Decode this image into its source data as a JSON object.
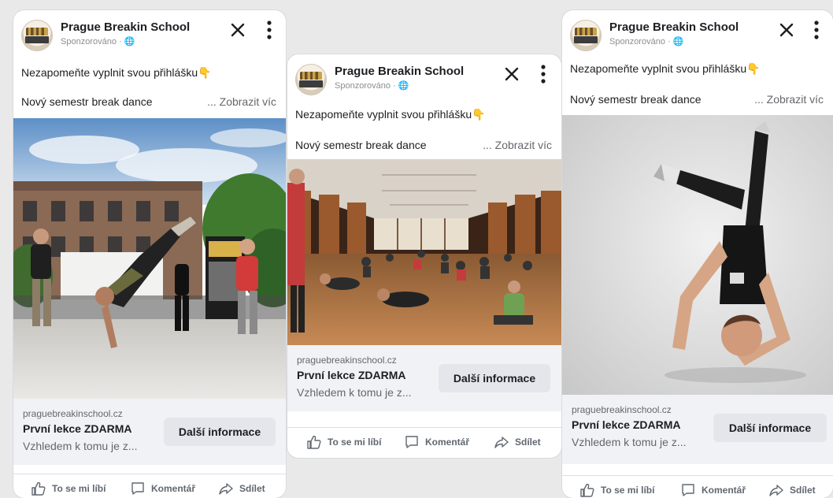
{
  "ads": [
    {
      "page_name": "Prague Breakin School",
      "sponsored": "Sponzorováno · 🌐",
      "caption_line1": "Nezapomeňte vyplnit svou přihlášku👇",
      "caption_line2": "Nový semestr break dance",
      "see_more": "... Zobrazit víc",
      "link_domain": "praguebreakinschool.cz",
      "link_headline": "První lekce ZDARMA",
      "link_description": "Vzhledem k tomu je z...",
      "cta_label": "Další informace",
      "actions": {
        "like": "To se mi líbí",
        "comment": "Komentář",
        "share": "Sdílet"
      }
    },
    {
      "page_name": "Prague Breakin School",
      "sponsored": "Sponzorováno · 🌐",
      "caption_line1": "Nezapomeňte vyplnit svou přihlášku👇",
      "caption_line2": "Nový semestr break dance",
      "see_more": "... Zobrazit víc",
      "link_domain": "praguebreakinschool.cz",
      "link_headline": "První lekce ZDARMA",
      "link_description": "Vzhledem k tomu je z...",
      "cta_label": "Další informace",
      "actions": {
        "like": "To se mi líbí",
        "comment": "Komentář",
        "share": "Sdílet"
      }
    },
    {
      "page_name": "Prague Breakin School",
      "sponsored": "Sponzorováno · 🌐",
      "caption_line1": "Nezapomeňte vyplnit svou přihlášku👇",
      "caption_line2": "Nový semestr break dance",
      "see_more": "... Zobrazit víc",
      "link_domain": "praguebreakinschool.cz",
      "link_headline": "První lekce ZDARMA",
      "link_description": "Vzhledem k tomu je z...",
      "cta_label": "Další informace",
      "actions": {
        "like": "To se mi líbí",
        "comment": "Komentář",
        "share": "Sdílet"
      }
    }
  ],
  "colors": {
    "page_background": "#e9e9ea",
    "card_background": "#ffffff",
    "cta_panel": "#f0f2f5",
    "cta_button": "#e4e6eb",
    "secondary_text": "#65676b"
  },
  "icons": [
    "avatar-logo",
    "close-icon",
    "more-vertical-icon",
    "like-icon",
    "comment-icon",
    "share-icon",
    "globe-icon"
  ]
}
